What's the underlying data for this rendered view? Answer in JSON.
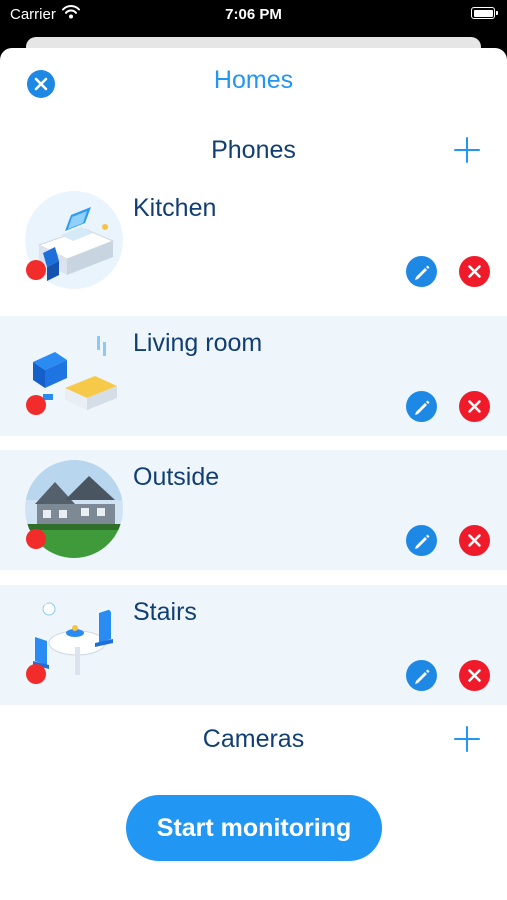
{
  "status_bar": {
    "carrier": "Carrier",
    "time": "7:06 PM"
  },
  "header": {
    "title": "Homes",
    "close_icon": "close-circle-icon"
  },
  "phones_section": {
    "label": "Phones",
    "add_icon": "plus-icon"
  },
  "rooms": [
    {
      "name": "Kitchen",
      "status": "red",
      "thumb_icon": "kitchen-illustration"
    },
    {
      "name": "Living room",
      "status": "red",
      "thumb_icon": "living-room-illustration"
    },
    {
      "name": "Outside",
      "status": "red",
      "thumb_icon": "house-photo"
    },
    {
      "name": "Stairs",
      "status": "red",
      "thumb_icon": "dining-illustration"
    }
  ],
  "row_actions": {
    "edit_icon": "pencil-icon",
    "delete_icon": "delete-x-icon"
  },
  "cameras_section": {
    "label": "Cameras",
    "add_icon": "plus-icon"
  },
  "footer": {
    "start_label": "Start monitoring"
  },
  "colors": {
    "accent_blue": "#2196f3",
    "dark_blue_text": "#123f73",
    "status_red": "#f22b2b",
    "delete_red": "#f01b2a",
    "row_shade": "#eef6fb"
  }
}
